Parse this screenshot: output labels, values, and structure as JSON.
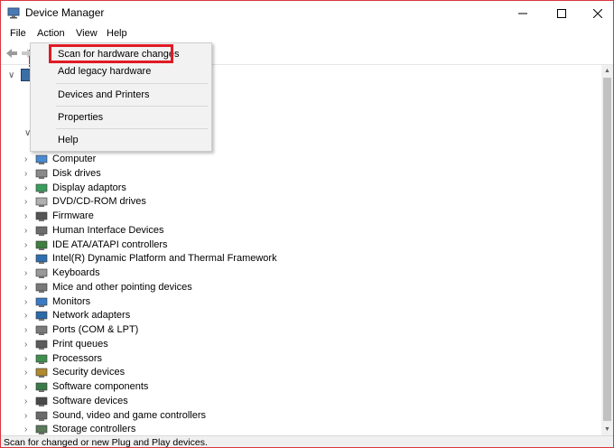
{
  "window": {
    "title": "Device Manager",
    "controls": {
      "minimize": "minimize-icon",
      "maximize": "maximize-icon",
      "close": "close-icon"
    }
  },
  "menubar": {
    "file": "File",
    "action": "Action",
    "view": "View",
    "help": "Help"
  },
  "action_menu": {
    "items": [
      {
        "label": "Scan for hardware changes",
        "highlighted": true
      },
      {
        "label": "Add legacy hardware"
      },
      {
        "label": "Devices and Printers"
      },
      {
        "label": "Properties"
      },
      {
        "label": "Help"
      }
    ]
  },
  "tree": {
    "items": [
      {
        "label": "Computer",
        "icon": "computer-icon"
      },
      {
        "label": "Disk drives",
        "icon": "disk-drive-icon"
      },
      {
        "label": "Display adaptors",
        "icon": "display-adapter-icon"
      },
      {
        "label": "DVD/CD-ROM drives",
        "icon": "dvd-drive-icon"
      },
      {
        "label": "Firmware",
        "icon": "firmware-icon"
      },
      {
        "label": "Human Interface Devices",
        "icon": "hid-icon"
      },
      {
        "label": "IDE ATA/ATAPI controllers",
        "icon": "ide-controller-icon"
      },
      {
        "label": "Intel(R) Dynamic Platform and Thermal Framework",
        "icon": "thermal-framework-icon"
      },
      {
        "label": "Keyboards",
        "icon": "keyboard-icon"
      },
      {
        "label": "Mice and other pointing devices",
        "icon": "mouse-icon"
      },
      {
        "label": "Monitors",
        "icon": "monitor-icon"
      },
      {
        "label": "Network adapters",
        "icon": "network-adapter-icon"
      },
      {
        "label": "Ports (COM & LPT)",
        "icon": "port-icon"
      },
      {
        "label": "Print queues",
        "icon": "printer-icon"
      },
      {
        "label": "Processors",
        "icon": "processor-icon"
      },
      {
        "label": "Security devices",
        "icon": "security-device-icon"
      },
      {
        "label": "Software components",
        "icon": "software-component-icon"
      },
      {
        "label": "Software devices",
        "icon": "software-device-icon"
      },
      {
        "label": "Sound, video and game controllers",
        "icon": "sound-icon"
      },
      {
        "label": "Storage controllers",
        "icon": "storage-controller-icon"
      }
    ]
  },
  "statusbar": {
    "text": "Scan for changed or new Plug and Play devices."
  },
  "colors": {
    "highlight_border": "#e01b24",
    "menu_background": "#f2f2f2",
    "menubar_selected": "#cce8ff"
  }
}
